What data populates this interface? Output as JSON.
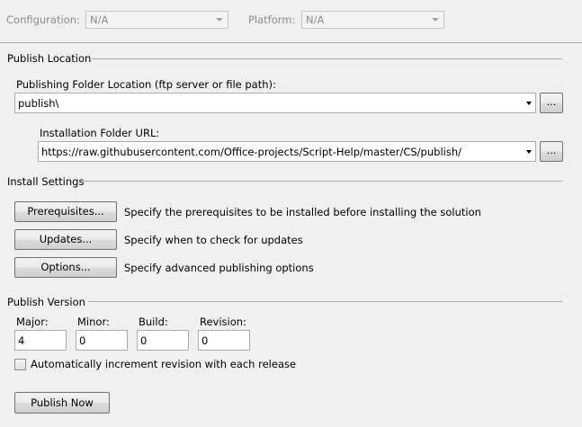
{
  "header": {
    "configuration_label": "Configuration:",
    "configuration_value": "N/A",
    "platform_label": "Platform:",
    "platform_value": "N/A"
  },
  "publish_location": {
    "group_label": "Publish Location",
    "folder_label": "Publishing Folder Location (ftp server or file path):",
    "folder_value": "publish\\",
    "browse_label": "...",
    "install_url_label": "Installation Folder URL:",
    "install_url_value": "https://raw.githubusercontent.com/Office-projects/Script-Help/master/CS/publish/",
    "install_browse_label": "..."
  },
  "install_settings": {
    "group_label": "Install Settings",
    "prerequisites_button": "Prerequisites...",
    "prerequisites_desc": "Specify the prerequisites to be installed before installing the solution",
    "updates_button": "Updates...",
    "updates_desc": "Specify when to check for updates",
    "options_button": "Options...",
    "options_desc": "Specify advanced publishing options"
  },
  "publish_version": {
    "group_label": "Publish Version",
    "major_label": "Major:",
    "major_value": "4",
    "minor_label": "Minor:",
    "minor_value": "0",
    "build_label": "Build:",
    "build_value": "0",
    "revision_label": "Revision:",
    "revision_value": "0",
    "auto_increment_label": "Automatically increment revision with each release",
    "auto_increment_checked": false
  },
  "actions": {
    "publish_now_button": "Publish Now"
  },
  "icons": {
    "dropdown": "chevron-down-icon",
    "checkbox": "checkbox-icon"
  },
  "colors": {
    "background": "#f0f0f0",
    "disabled_text": "#8c8c8c",
    "input_border": "#abadb3",
    "button_border": "#707070"
  }
}
